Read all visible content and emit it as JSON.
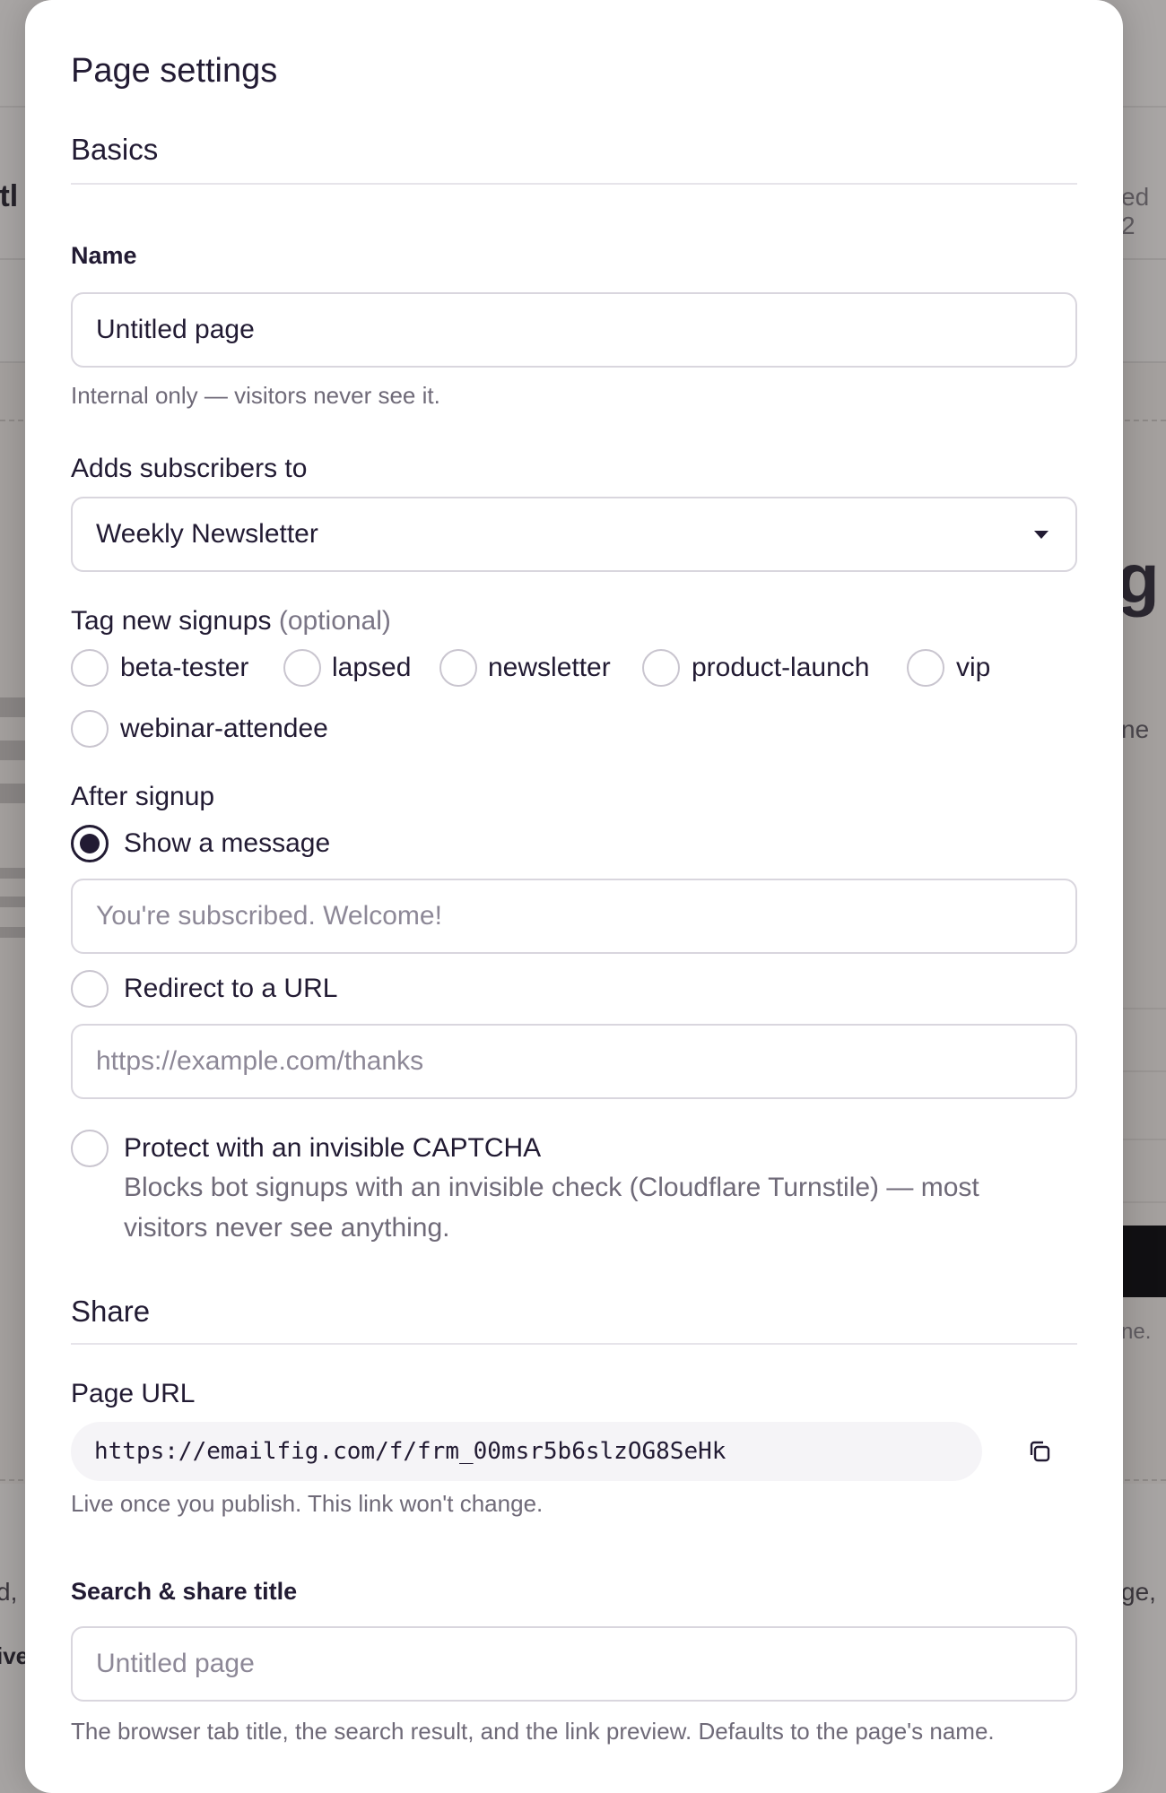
{
  "modal": {
    "title": "Page settings"
  },
  "basics": {
    "section_title": "Basics",
    "name_label": "Name",
    "name_value": "Untitled page",
    "name_hint": "Internal only — visitors never see it.",
    "list_label": "Adds subscribers to",
    "list_value": "Weekly Newsletter",
    "tags_label": "Tag new signups",
    "tags_optional": "(optional)",
    "tags": [
      {
        "label": "beta-tester",
        "checked": false
      },
      {
        "label": "lapsed",
        "checked": false
      },
      {
        "label": "newsletter",
        "checked": false
      },
      {
        "label": "product-launch",
        "checked": false
      },
      {
        "label": "vip",
        "checked": false
      },
      {
        "label": "webinar-attendee",
        "checked": false
      }
    ],
    "after_label": "After signup",
    "after_options": {
      "message": {
        "label": "Show a message",
        "checked": true,
        "placeholder": "You're subscribed. Welcome!"
      },
      "redirect": {
        "label": "Redirect to a URL",
        "checked": false,
        "placeholder": "https://example.com/thanks"
      }
    },
    "captcha": {
      "title": "Protect with an invisible CAPTCHA",
      "description": "Blocks bot signups with an invisible check (Cloudflare Turnstile) — most visitors never see anything.",
      "checked": false
    }
  },
  "share": {
    "section_title": "Share",
    "url_label": "Page URL",
    "url_value": "https://emailfig.com/f/frm_00msr5b6slzOG8SeHk",
    "url_hint": "Live once you publish. This link won't change.",
    "seo_title_label": "Search & share title",
    "seo_title_placeholder": "Untitled page",
    "seo_title_hint": "The browser tab title, the search result, and the link preview. Defaults to the page's name."
  },
  "backdrop": {
    "left_fragment": "itl",
    "right_fragment": "ed 2",
    "right_big": "g",
    "right_ne": "ne",
    "right_ne2": "ne.",
    "bottom_left": "d,",
    "bottom_left2": "ive",
    "bottom_right": "ge,"
  },
  "colors": {
    "accent": "#221b33",
    "backdrop": "#a7a4a3",
    "border": "#d9d6de",
    "muted_text": "#6f6a78"
  },
  "icons": {
    "copy": "copy-icon",
    "dropdown": "chevron-down-icon"
  }
}
